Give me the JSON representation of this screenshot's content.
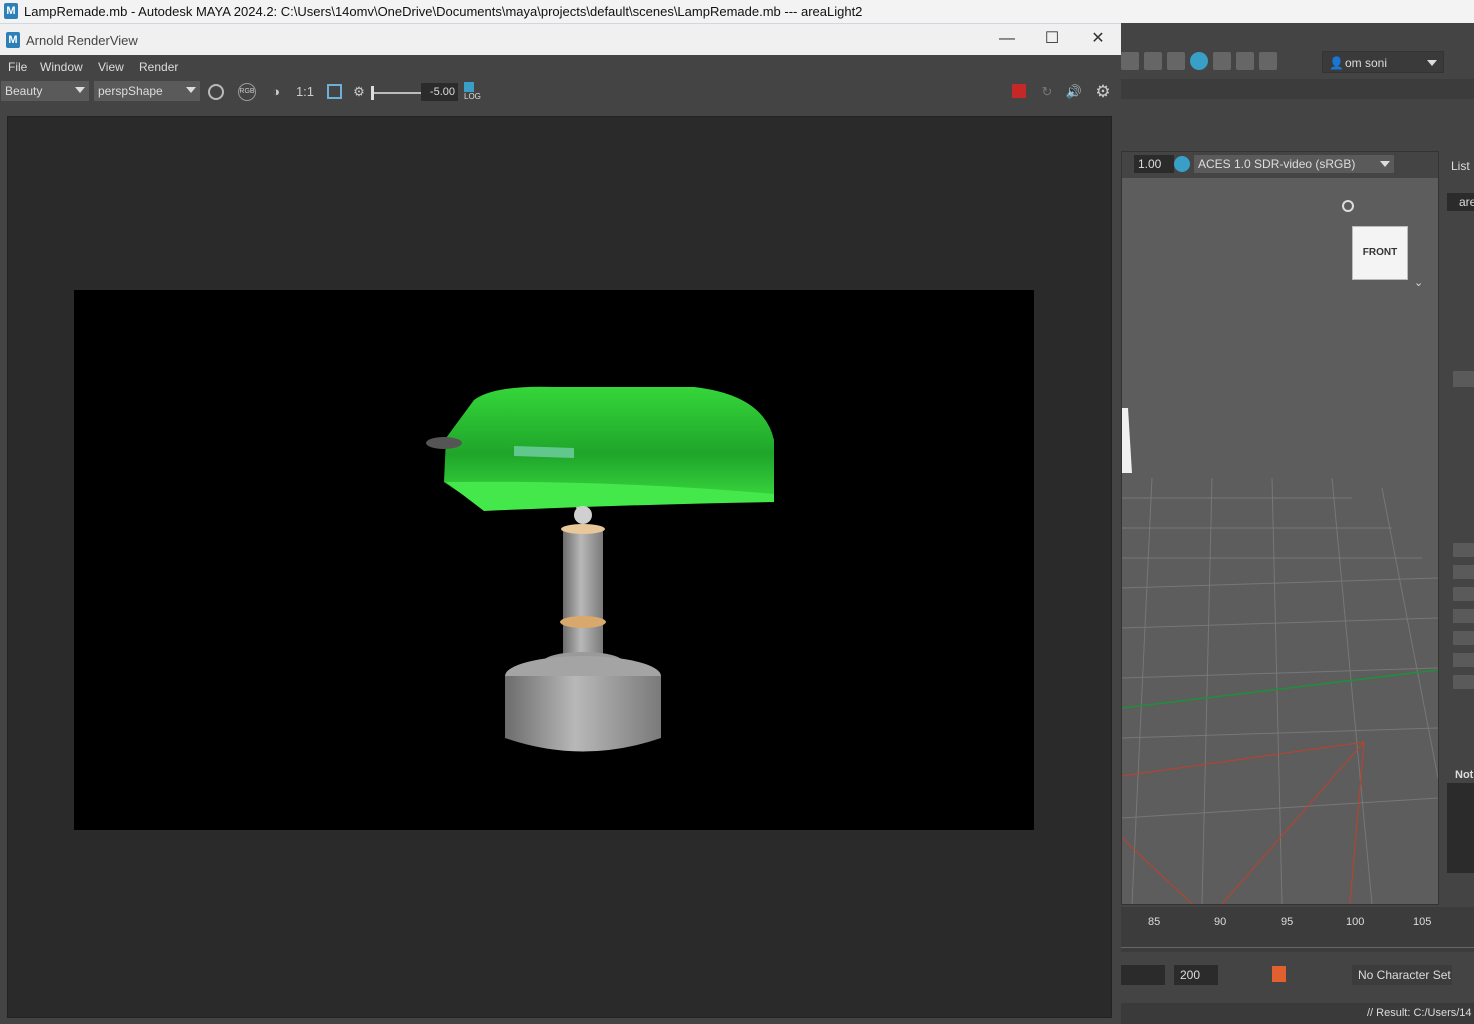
{
  "maya_window": {
    "title": "LampRemade.mb - Autodesk MAYA 2024.2: C:\\Users\\14omv\\OneDrive\\Documents\\maya\\projects\\default\\scenes\\LampRemade.mb   ---   areaLight2",
    "logo": "M"
  },
  "maya_side": {
    "user_menu": "om soni",
    "exposure_value": "1.00",
    "color_space": "ACES 1.0 SDR-video (sRGB)",
    "viewcube_label": "FRONT",
    "right_panel_list": "List",
    "right_panel_field": "are",
    "right_panel_notes": "Not",
    "timeline_ticks": [
      "85",
      "90",
      "95",
      "100",
      "105"
    ],
    "end_frame": "200",
    "character_set": "No Character Set",
    "command_result": "// Result: C:/Users/14"
  },
  "arnold": {
    "title": "Arnold RenderView",
    "icon": "M",
    "menus": [
      "File",
      "Window",
      "View",
      "Render"
    ],
    "aov": "Beauty",
    "camera": "perspShape",
    "ratio_label": "1:1",
    "exposure": "-5.00",
    "log_label": "LOG",
    "rgb_label": "RGB"
  },
  "colors": {
    "lampshade": "#2ecc2e",
    "stop_button": "#c62828",
    "accent_blue": "#2d7fb8"
  }
}
